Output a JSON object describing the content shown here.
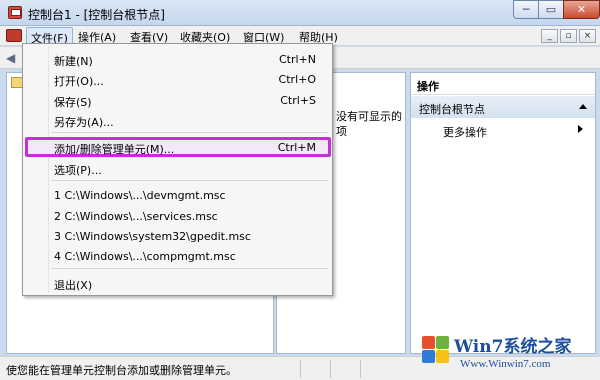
{
  "window": {
    "title": "控制台1 - [控制台根节点]",
    "min": "─",
    "max": "▭",
    "close": "✕"
  },
  "menubar": {
    "items": [
      "文件(F)",
      "操作(A)",
      "查看(V)",
      "收藏夹(O)",
      "窗口(W)",
      "帮助(H)"
    ],
    "mdi_min": "_",
    "mdi_restore": "▫",
    "mdi_close": "×"
  },
  "file_menu": {
    "items": [
      {
        "label": "新建(N)",
        "shortcut": "Ctrl+N"
      },
      {
        "label": "打开(O)...",
        "shortcut": "Ctrl+O"
      },
      {
        "label": "保存(S)",
        "shortcut": "Ctrl+S"
      },
      {
        "label": "另存为(A)...",
        "shortcut": ""
      },
      {
        "label": "添加/删除管理单元(M)...",
        "shortcut": "Ctrl+M"
      },
      {
        "label": "选项(P)...",
        "shortcut": ""
      },
      {
        "label": "1 C:\\Windows\\...\\devmgmt.msc",
        "shortcut": ""
      },
      {
        "label": "2 C:\\Windows\\...\\services.msc",
        "shortcut": ""
      },
      {
        "label": "3 C:\\Windows\\system32\\gpedit.msc",
        "shortcut": ""
      },
      {
        "label": "4 C:\\Windows\\...\\compmgmt.msc",
        "shortcut": ""
      },
      {
        "label": "退出(X)",
        "shortcut": ""
      }
    ]
  },
  "center": {
    "text": "没有可显示的项"
  },
  "actions": {
    "header": "操作",
    "group": "控制台根节点",
    "more": "更多操作"
  },
  "statusbar": {
    "text": "使您能在管理单元控制台添加或删除管理单元。"
  },
  "watermark": {
    "title": "Win7系统之家",
    "url": "Www.Winwin7.com"
  },
  "colors": {
    "highlight_border": "#c42fd8",
    "titlebar": "#c4d7ee",
    "menu_bg": "#f6f6f6"
  }
}
